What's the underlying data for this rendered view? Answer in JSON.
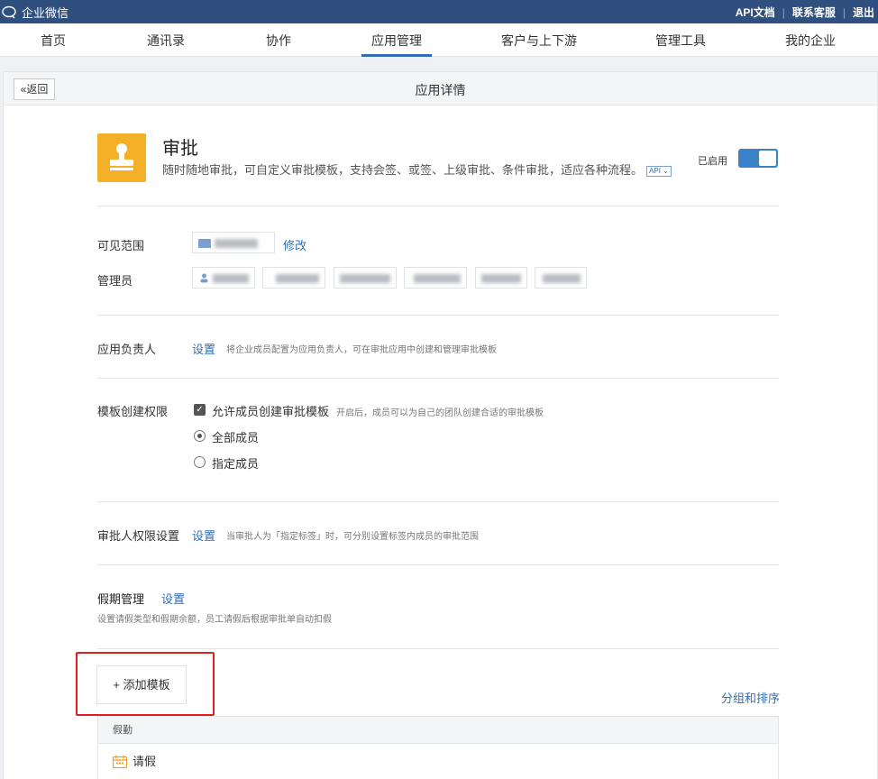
{
  "topbar": {
    "brand": "企业微信",
    "links": [
      "API文档",
      "联系客服",
      "退出"
    ]
  },
  "nav": {
    "items": [
      "首页",
      "通讯录",
      "协作",
      "应用管理",
      "客户与上下游",
      "管理工具",
      "我的企业"
    ],
    "active": "应用管理"
  },
  "panel": {
    "back_label": "返回",
    "title": "应用详情"
  },
  "app": {
    "name": "审批",
    "description": "随时随地审批，可自定义审批模板，支持会签、或签、上级审批、条件审批，适应各种流程。",
    "api_tag": "API",
    "status_label": "已启用",
    "enabled": true,
    "icon_color": "#f4b026"
  },
  "visibility": {
    "label": "可见范围",
    "modify_link": "修改"
  },
  "admins": {
    "label": "管理员"
  },
  "owner": {
    "label": "应用负责人",
    "link": "设置",
    "hint": "将企业成员配置为应用负责人，可在审批应用中创建和管理审批模板"
  },
  "template_permission": {
    "label": "模板创建权限",
    "checkbox_label": "允许成员创建审批模板",
    "checkbox_checked": true,
    "hint": "开启后，成员可以为自己的团队创建合适的审批模板",
    "options": [
      "全部成员",
      "指定成员"
    ],
    "selected": "全部成员"
  },
  "approver_scope": {
    "label": "审批人权限设置",
    "link": "设置",
    "hint": "当审批人为「指定标签」时，可分别设置标签内成员的审批范围"
  },
  "leave": {
    "label": "假期管理",
    "link": "设置",
    "hint": "设置请假类型和假期余额，员工请假后根据审批单自动扣假"
  },
  "templates": {
    "add_button": "+ 添加模板",
    "sort_link": "分组和排序",
    "group_name": "假勤",
    "items": [
      "请假"
    ]
  },
  "colors": {
    "topbar": "#2f4f7f",
    "accent": "#2f6eb5",
    "highlight_box": "#e02020"
  }
}
